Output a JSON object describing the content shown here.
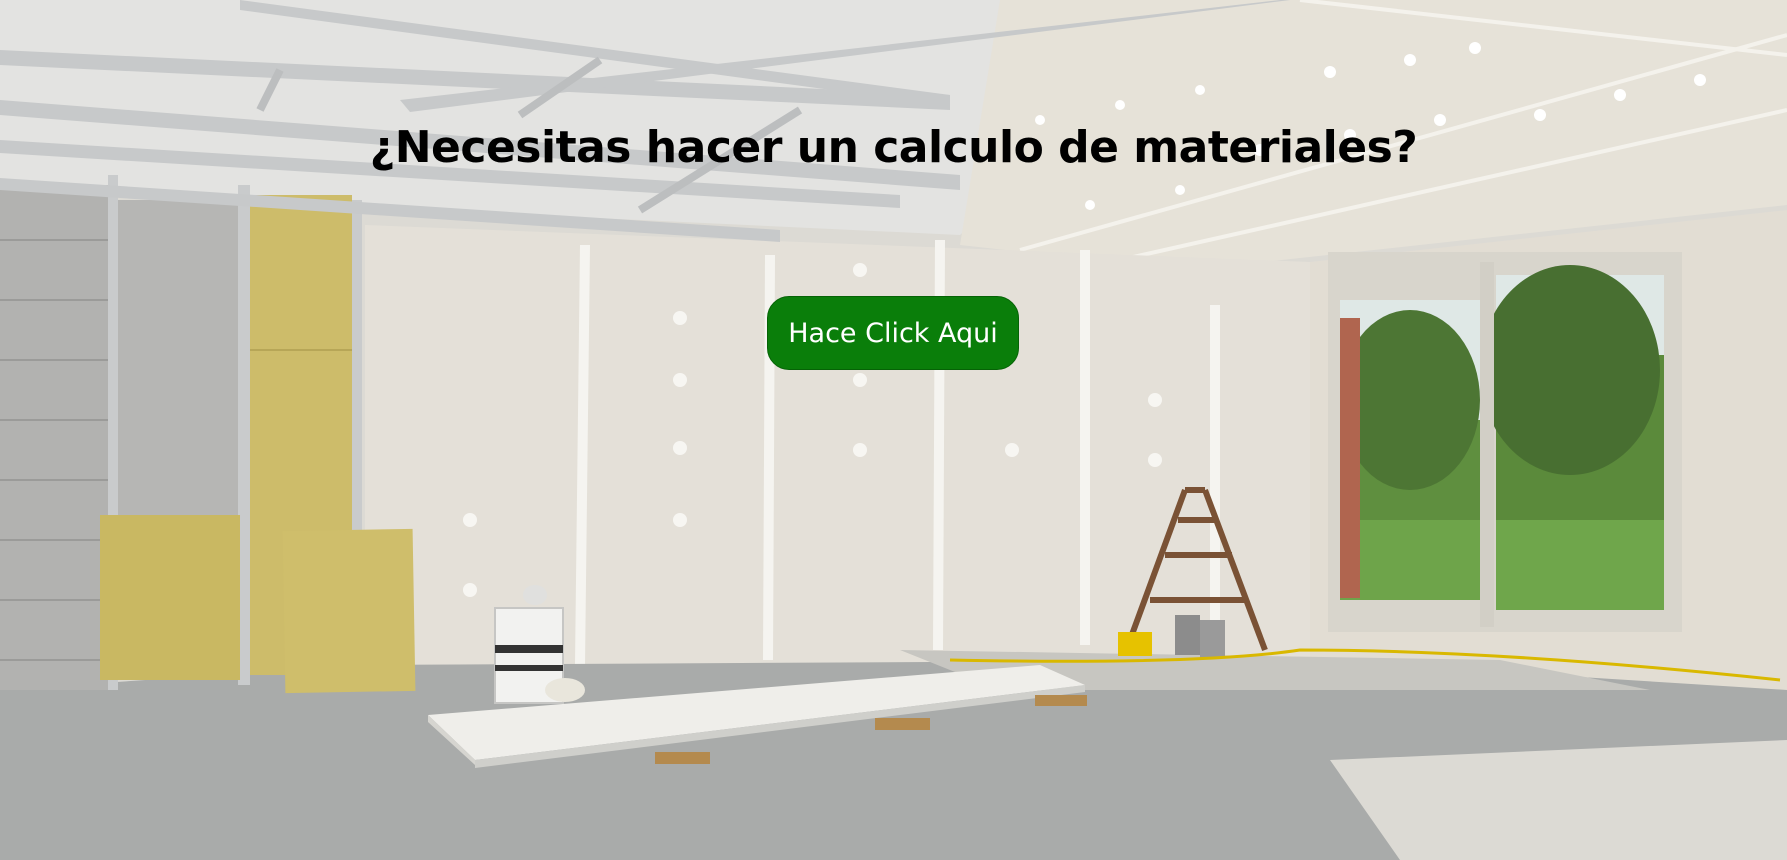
{
  "hero": {
    "headline": "¿Necesitas hacer un calculo de materiales?",
    "cta_label": "Hace Click Aqui"
  },
  "colors": {
    "cta_background": "#0a7e0a",
    "cta_text": "#ffffff",
    "headline_text": "#000000"
  },
  "icons": [
    "construction-scene-image"
  ]
}
